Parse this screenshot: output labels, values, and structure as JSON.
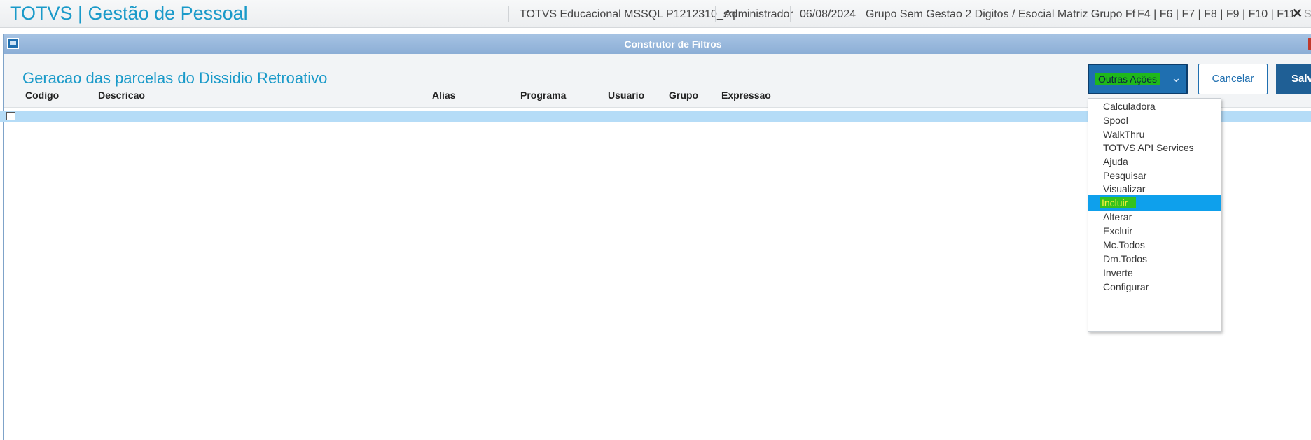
{
  "app": {
    "title": "TOTVS | Gestão de Pessoal"
  },
  "header": {
    "environment": "TOTVS Educacional MSSQL P1212310_sql",
    "user": "Administrador",
    "date": "06/08/2024",
    "company": "Grupo Sem Gestao 2 Digitos / Esocial Matriz Grupo Ff",
    "shortcuts": "F4 | F6 | F7 | F8 | F9 | F10 | F11",
    "close_glyph": "✕",
    "cut_text": "S"
  },
  "dialog": {
    "title": "Construtor de Filtros",
    "heading": "Geracao das parcelas do Dissidio Retroativo",
    "buttons": {
      "other_actions": "Outras Ações",
      "cancel": "Cancelar",
      "save": "Salvar"
    }
  },
  "grid": {
    "columns": [
      "Codigo",
      "Descricao",
      "Alias",
      "Programa",
      "Usuario",
      "Grupo",
      "Expressao"
    ]
  },
  "menu": {
    "items": [
      "Calculadora",
      "Spool",
      "WalkThru",
      "TOTVS API Services",
      "Ajuda",
      "Pesquisar",
      "Visualizar",
      "Incluir",
      "Alterar",
      "Excluir",
      "Mc.Todos",
      "Dm.Todos",
      "Inverte",
      "Configurar"
    ],
    "active_index": 7
  },
  "colors": {
    "accent": "#1a9ac9",
    "button_primary": "#1f6fb0",
    "row_selected": "#b5dcf7",
    "menu_active": "#0ea0ec",
    "highlight_marker": "#1fb81a"
  },
  "icons": {
    "dialog_icon": "window-icon",
    "dropdown": "chevron-down-icon",
    "close": "close-icon"
  }
}
